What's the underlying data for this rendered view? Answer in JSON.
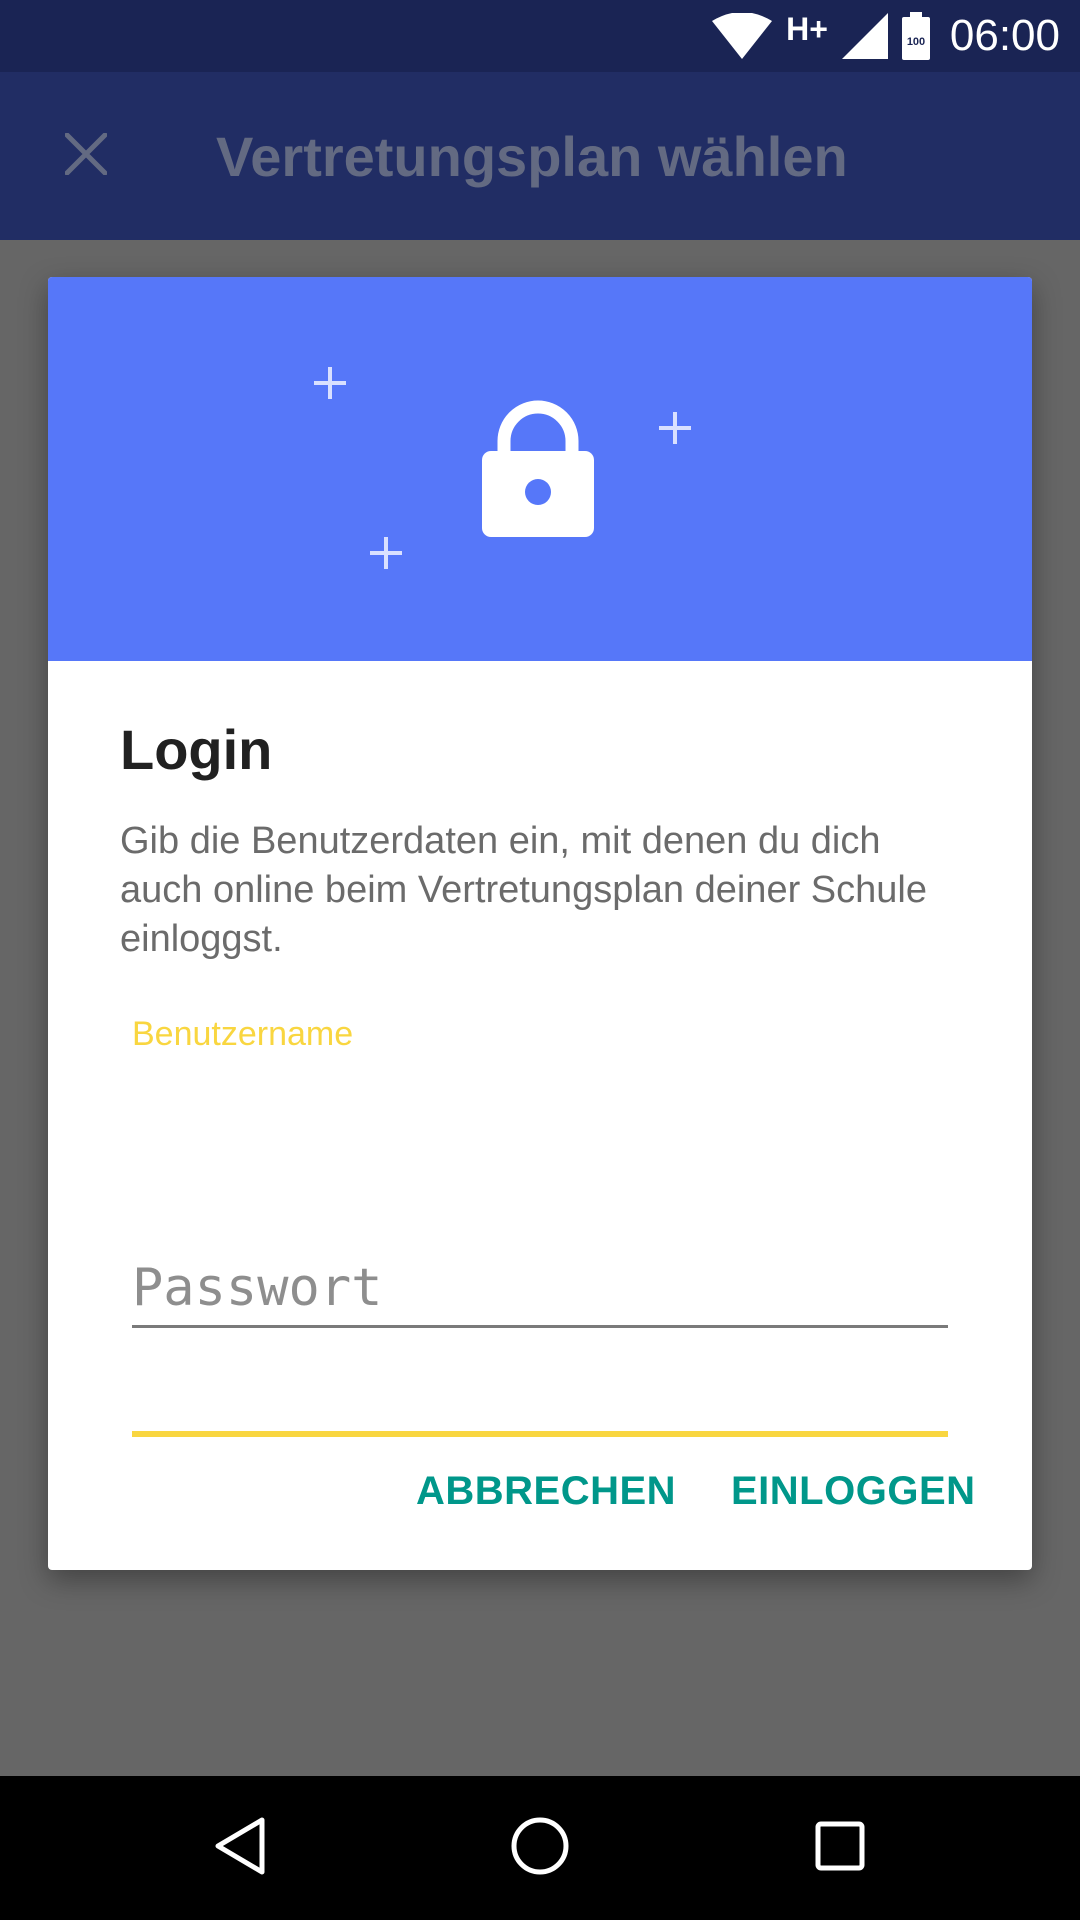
{
  "status_bar": {
    "network_type": "H+",
    "battery_level": "100",
    "time": "06:00",
    "icons": [
      "wifi-icon",
      "network-type",
      "cell-signal-icon",
      "battery-icon"
    ]
  },
  "app_bar": {
    "close_icon": "close-icon",
    "title": "Vertretungsplan wählen"
  },
  "dialog": {
    "header_icon": "lock-icon",
    "header_color": "#5677f9",
    "title": "Login",
    "message": "Gib die Benutzerdaten ein, mit denen du dich auch online beim Vertretungsplan deiner Schule einloggst.",
    "username": {
      "label": "Benutzername",
      "value": ""
    },
    "password": {
      "placeholder": "Passwort",
      "value": ""
    },
    "buttons": {
      "cancel": "ABBRECHEN",
      "login": "EINLOGGEN"
    },
    "accent_color": "#00978a",
    "focus_color": "#f9d640"
  },
  "nav_bar": {
    "icons": [
      "back-icon",
      "home-icon",
      "recents-icon"
    ]
  }
}
